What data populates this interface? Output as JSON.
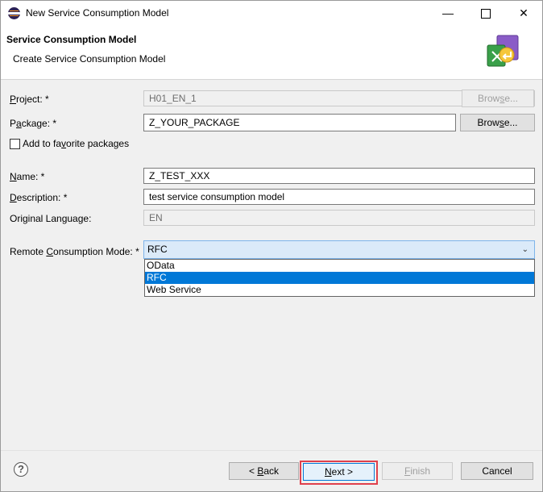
{
  "window": {
    "title": "New Service Consumption Model",
    "controls": {
      "minimize": "—",
      "close": "✕"
    }
  },
  "header": {
    "title": "Service Consumption Model",
    "subtitle": "Create Service Consumption Model",
    "icon": "wizard-banner-icon"
  },
  "form": {
    "project": {
      "label_pre": "P",
      "label_post": "roject: *",
      "value": "H01_EN_1",
      "browse_label_pre": "Brow",
      "browse_label_u": "s",
      "browse_label_post": "e..."
    },
    "package": {
      "label_pre": "P",
      "label_u": "a",
      "label_post": "ckage: *",
      "value": "Z_YOUR_PACKAGE",
      "browse_label_pre": "Brow",
      "browse_label_u": "s",
      "browse_label_post": "e..."
    },
    "favorite": {
      "label_pre": "Add to fa",
      "label_u": "v",
      "label_post": "orite packages",
      "checked": false
    },
    "name": {
      "label_pre": "N",
      "label_post": "ame: *",
      "value": "Z_TEST_XXX"
    },
    "description": {
      "label_pre": "D",
      "label_post": "escription: *",
      "value": "test service consumption model"
    },
    "original_language": {
      "label": "Original Language:",
      "value": "EN"
    },
    "remote_mode": {
      "label_pre": "Remote ",
      "label_u": "C",
      "label_post": "onsumption Mode: *",
      "value": "RFC",
      "options": [
        "OData",
        "RFC",
        "Web Service"
      ],
      "selected_index": 1
    }
  },
  "footer": {
    "help_glyph": "?",
    "back": {
      "pre": "< ",
      "u": "B",
      "post": "ack"
    },
    "next": {
      "u": "N",
      "post": "ext >"
    },
    "finish": {
      "u": "F",
      "post": "inish"
    },
    "cancel": "Cancel",
    "highlight_color": "#e0404c"
  }
}
